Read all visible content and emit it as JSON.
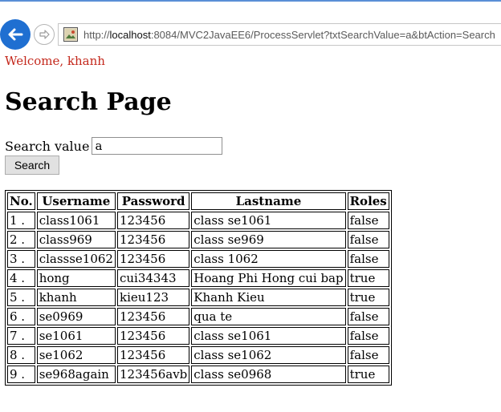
{
  "browser": {
    "url_prefix": "http://",
    "url_host": "localhost",
    "url_rest": ":8084/MVC2JavaEE6/ProcessServlet?txtSearchValue=a&btAction=Search"
  },
  "page": {
    "welcome": "Welcome, khanh",
    "title": "Search Page",
    "search_label": "Search value",
    "search_value": "a",
    "search_button": "Search"
  },
  "table": {
    "headers": [
      "No.",
      "Username",
      "Password",
      "Lastname",
      "Roles"
    ],
    "rows": [
      [
        "1 .",
        "class1061",
        "123456",
        "class se1061",
        "false"
      ],
      [
        "2 .",
        "class969",
        "123456",
        "class se969",
        "false"
      ],
      [
        "3 .",
        "classse1062",
        "123456",
        "class 1062",
        "false"
      ],
      [
        "4 .",
        "hong",
        "cui34343",
        "Hoang Phi Hong cui bap",
        "true"
      ],
      [
        "5 .",
        "khanh",
        "kieu123",
        "Khanh Kieu",
        "true"
      ],
      [
        "6 .",
        "se0969",
        "123456",
        "qua te",
        "false"
      ],
      [
        "7 .",
        "se1061",
        "123456",
        "class se1061",
        "false"
      ],
      [
        "8 .",
        "se1062",
        "123456",
        "class se1062",
        "false"
      ],
      [
        "9 .",
        "se968again",
        "123456avb",
        "class se0968",
        "true"
      ]
    ]
  }
}
